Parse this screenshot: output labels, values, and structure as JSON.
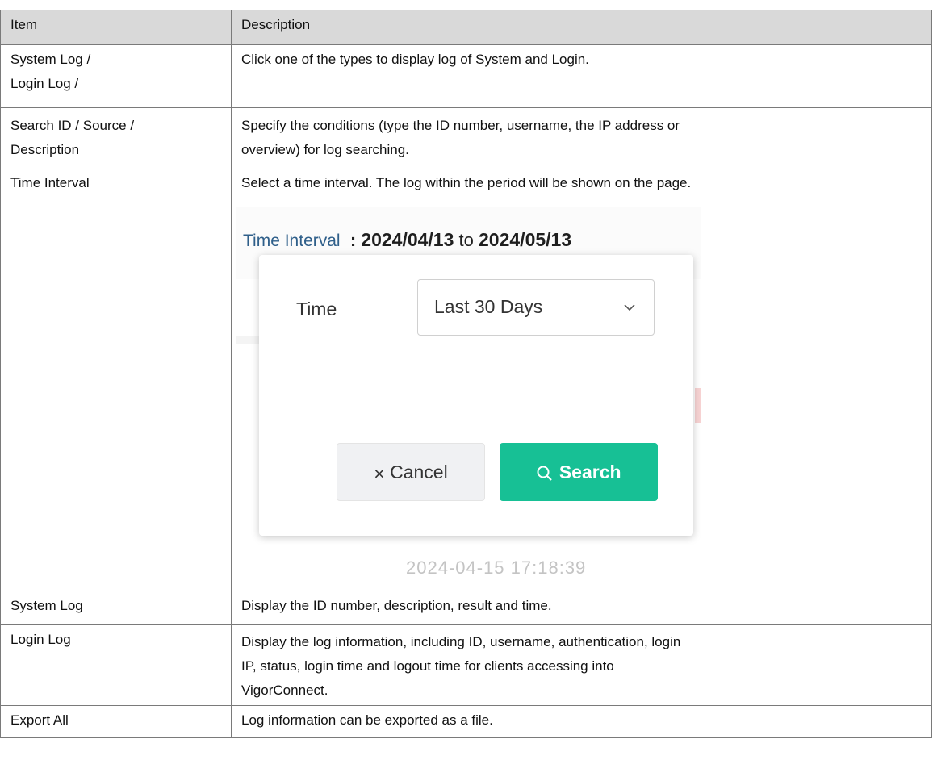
{
  "header": {
    "item": "Item",
    "description": "Description"
  },
  "rows": [
    {
      "item_lines": [
        "System Log /",
        "Login Log /"
      ],
      "description": "Click one of the types to display log of System and Login."
    },
    {
      "item_lines": [
        "Search ID / Source /",
        "Description"
      ],
      "description_lines": [
        "Specify the conditions (type the ID number, username, the IP address or",
        "overview) for log searching."
      ]
    },
    {
      "item": "Time Interval",
      "description": "Select a time interval. The log within the period will be shown on the page."
    },
    {
      "item": "System Log",
      "description": "Display the ID number, description, result and time."
    },
    {
      "item": "Login Log",
      "description_lines": [
        "Display the log information, including ID, username, authentication, login",
        "IP, status, login time and logout time for clients accessing into",
        "VigorConnect."
      ]
    },
    {
      "item": "Export All",
      "description": "Log information can be exported as a file."
    }
  ],
  "screenshot": {
    "label": "Time Interval",
    "separator": ":",
    "start_date": "2024/04/13",
    "to": "to",
    "end_date": "2024/05/13",
    "time_label": "Time",
    "time_value": "Last 30 Days",
    "cancel_label": "Cancel",
    "search_label": "Search",
    "background_timestamp": "2024-04-15 17:18:39",
    "icons": {
      "cancel": "close-icon",
      "search": "search-icon",
      "select": "chevron-down-icon"
    },
    "colors": {
      "search_button": "#17c095",
      "label": "#2f5f8a"
    }
  }
}
